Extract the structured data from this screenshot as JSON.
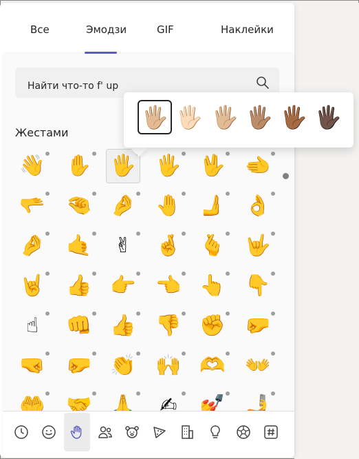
{
  "tabs": [
    {
      "label": "Все"
    },
    {
      "label": "Эмодзи"
    },
    {
      "label": "GIF"
    },
    {
      "label": "Наклейки"
    }
  ],
  "search": {
    "value": "Найти что-то f' up",
    "icon": "search-icon"
  },
  "section": {
    "title": "Жестами"
  },
  "skin_tones": {
    "emoji": [
      "🖐🏼",
      "🖐🏻",
      "🖐🏼",
      "🖐🏽",
      "🖐🏾",
      "🖐🏿"
    ],
    "swatches": [
      "#ffc83d",
      "#f7dece",
      "#f3d2a2",
      "#d5ab88",
      "#af7e57",
      "#7c533e"
    ],
    "selected_index": 0
  },
  "emoji_rows": [
    [
      "👋",
      "✋",
      "🖐",
      "🖐",
      "🖖",
      "🫲"
    ],
    [
      "🫳",
      "🤏",
      "🤌",
      "🤚",
      "🫸",
      "👌"
    ],
    [
      "🤌",
      "🤙",
      "✌",
      "🤞",
      "🫰",
      "🤟"
    ],
    [
      "🤘",
      "👍",
      "👉",
      "👈",
      "👆",
      "👇"
    ],
    [
      "☝",
      "👊",
      "👍",
      "👎",
      "✊",
      "🤛"
    ],
    [
      "🤜",
      "🤛",
      "👏",
      "🙌",
      "🫶",
      "👐"
    ],
    [
      "🤲",
      "🤝",
      "🙏",
      "✍",
      "💅",
      "🤳"
    ]
  ],
  "selected_cell": {
    "row": 0,
    "col": 2
  },
  "categories": [
    {
      "name": "recent-icon"
    },
    {
      "name": "smiley-icon"
    },
    {
      "name": "hand-icon"
    },
    {
      "name": "people-icon"
    },
    {
      "name": "animal-icon"
    },
    {
      "name": "food-icon"
    },
    {
      "name": "building-icon"
    },
    {
      "name": "lightbulb-icon"
    },
    {
      "name": "soccer-ball-icon"
    },
    {
      "name": "hashtag-icon"
    }
  ],
  "active_category": 2,
  "accent_color": "#5b5fc7"
}
